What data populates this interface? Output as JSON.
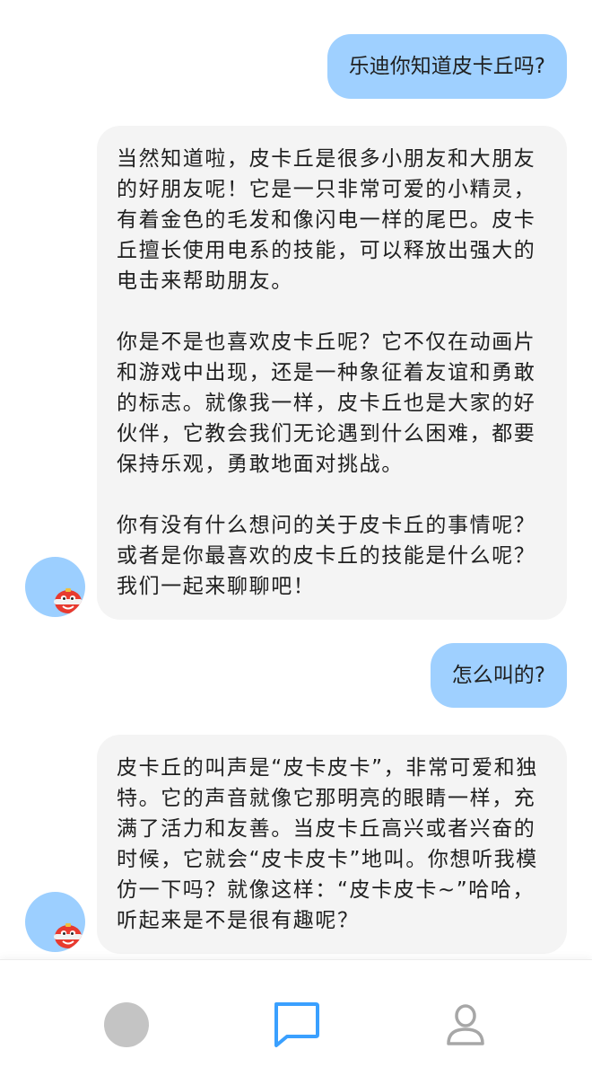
{
  "colors": {
    "user_bubble": "#9fd0ff",
    "bot_bubble": "#f4f4f4",
    "avatar_bg": "#9ccfff",
    "active_tab": "#3aa0ff",
    "inactive_tab": "#a7a7a7"
  },
  "messages": [
    {
      "role": "user",
      "text": "乐迪你知道皮卡丘吗?"
    },
    {
      "role": "bot",
      "avatar_icon": "jett-avatar-icon",
      "paragraphs": [
        "当然知道啦，皮卡丘是很多小朋友和大朋友的好朋友呢！它是一只非常可爱的小精灵，有着金色的毛发和像闪电一样的尾巴。皮卡丘擅长使用电系的技能，可以释放出强大的电击来帮助朋友。",
        "你是不是也喜欢皮卡丘呢？它不仅在动画片和游戏中出现，还是一种象征着友谊和勇敢的标志。就像我一样，皮卡丘也是大家的好伙伴，它教会我们无论遇到什么困难，都要保持乐观，勇敢地面对挑战。",
        "你有没有什么想问的关于皮卡丘的事情呢？或者是你最喜欢的皮卡丘的技能是什么呢？我们一起来聊聊吧！"
      ]
    },
    {
      "role": "user",
      "text": "怎么叫的?"
    },
    {
      "role": "bot",
      "avatar_icon": "jett-avatar-icon",
      "paragraphs": [
        "皮卡丘的叫声是“皮卡皮卡”，非常可爱和独特。它的声音就像它那明亮的眼睛一样，充满了活力和友善。当皮卡丘高兴或者兴奋的时候，它就会“皮卡皮卡”地叫。你想听我模仿一下吗？就像这样：“皮卡皮卡~”哈哈，听起来是不是很有趣呢？"
      ]
    }
  ],
  "bottom_nav": [
    {
      "icon": "home-icon",
      "active": false
    },
    {
      "icon": "chat-icon",
      "active": true
    },
    {
      "icon": "profile-icon",
      "active": false
    }
  ]
}
